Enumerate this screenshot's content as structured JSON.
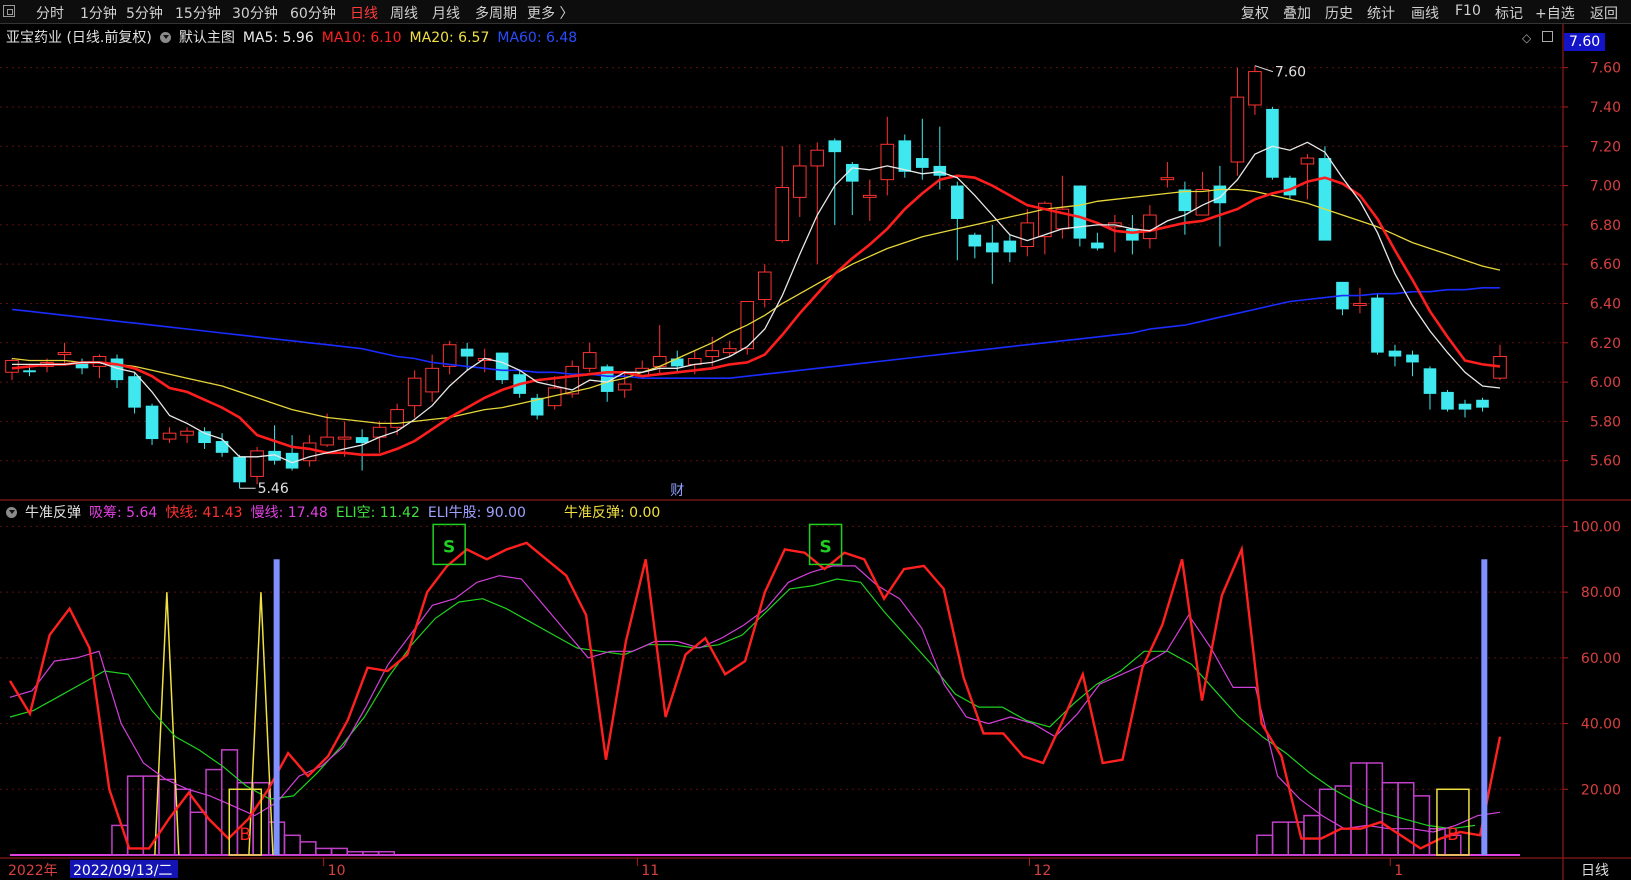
{
  "toolbar": {
    "left_items": [
      "分时",
      "1分钟",
      "5分钟",
      "15分钟",
      "30分钟",
      "60分钟",
      "日线",
      "周线",
      "月线",
      "多周期",
      "更多 〉"
    ],
    "active": "日线",
    "right_items": [
      "复权",
      "叠加",
      "历史",
      "统计",
      "画线",
      "F10",
      "标记",
      "+自选",
      "返回"
    ]
  },
  "main_legend": {
    "stock": "亚宝药业 (日线.前复权)",
    "template": "默认主图",
    "ma5": "MA5: 5.96",
    "ma10": "MA10: 6.10",
    "ma20": "MA20: 6.57",
    "ma60": "MA60: 6.48",
    "ma5_color": "#e8e8e8",
    "ma10_color": "#ff2020",
    "ma20_color": "#f0e040",
    "ma60_color": "#2038ff"
  },
  "sub_legend": {
    "name": "牛准反弹",
    "xichou": "吸筹: 5.64",
    "kuaixian": "快线: 41.43",
    "manxian": "慢线: 17.48",
    "elikong": "ELI空: 11.42",
    "eliniugu": "ELI牛股: 90.00",
    "niuzhun": "牛准反弹: 0.00",
    "xichou_color": "#e040e0",
    "kuaixian_color": "#ff3030",
    "manxian_color": "#e040e0",
    "elikong_color": "#40e040",
    "eliniugu_color": "#a0a0ff",
    "niuzhun_color": "#f0e040"
  },
  "price_tag": "7.60",
  "bottom_right_tab": "日线",
  "chart_data": [
    {
      "type": "candlestick",
      "ylim": [
        5.4,
        7.7
      ],
      "yticks": [
        "7.60",
        "7.40",
        "7.20",
        "7.00",
        "6.80",
        "6.60",
        "6.40",
        "6.20",
        "6.00",
        "5.80",
        "5.60"
      ],
      "annotations": {
        "high_label": "7.60",
        "low_label": "5.46",
        "event_mark": "财"
      },
      "candles": [
        [
          6.05,
          6.11,
          6.12,
          6.01
        ],
        [
          6.06,
          6.05,
          6.09,
          6.03
        ],
        [
          6.08,
          6.1,
          6.12,
          6.05
        ],
        [
          6.14,
          6.15,
          6.2,
          6.09
        ],
        [
          6.1,
          6.07,
          6.12,
          6.04
        ],
        [
          6.08,
          6.13,
          6.14,
          6.02
        ],
        [
          6.12,
          6.01,
          6.14,
          5.97
        ],
        [
          6.03,
          5.87,
          6.05,
          5.84
        ],
        [
          5.88,
          5.71,
          5.89,
          5.68
        ],
        [
          5.71,
          5.74,
          5.77,
          5.69
        ],
        [
          5.73,
          5.75,
          5.77,
          5.69
        ],
        [
          5.75,
          5.69,
          5.77,
          5.66
        ],
        [
          5.7,
          5.64,
          5.74,
          5.62
        ],
        [
          5.62,
          5.49,
          5.63,
          5.46
        ],
        [
          5.52,
          5.65,
          5.67,
          5.48
        ],
        [
          5.65,
          5.6,
          5.78,
          5.58
        ],
        [
          5.64,
          5.56,
          5.73,
          5.55
        ],
        [
          5.6,
          5.69,
          5.73,
          5.57
        ],
        [
          5.68,
          5.72,
          5.84,
          5.67
        ],
        [
          5.71,
          5.72,
          5.8,
          5.62
        ],
        [
          5.72,
          5.69,
          5.76,
          5.55
        ],
        [
          5.72,
          5.77,
          5.8,
          5.64
        ],
        [
          5.77,
          5.86,
          5.89,
          5.73
        ],
        [
          5.88,
          6.02,
          6.06,
          5.82
        ],
        [
          5.95,
          6.07,
          6.14,
          5.9
        ],
        [
          6.08,
          6.19,
          6.21,
          6.04
        ],
        [
          6.17,
          6.13,
          6.2,
          6.06
        ],
        [
          6.11,
          6.12,
          6.17,
          6.05
        ],
        [
          6.15,
          6.01,
          6.15,
          5.99
        ],
        [
          6.04,
          5.94,
          6.06,
          5.92
        ],
        [
          5.92,
          5.83,
          5.94,
          5.81
        ],
        [
          5.88,
          5.97,
          6.03,
          5.86
        ],
        [
          5.94,
          6.08,
          6.11,
          5.92
        ],
        [
          6.07,
          6.15,
          6.2,
          6.05
        ],
        [
          6.08,
          5.95,
          6.09,
          5.9
        ],
        [
          5.96,
          5.99,
          6.05,
          5.92
        ],
        [
          6.03,
          6.07,
          6.11,
          6.02
        ],
        [
          6.08,
          6.13,
          6.29,
          6.04
        ],
        [
          6.12,
          6.08,
          6.16,
          6.05
        ],
        [
          6.09,
          6.12,
          6.16,
          6.04
        ],
        [
          6.13,
          6.16,
          6.23,
          6.08
        ],
        [
          6.15,
          6.17,
          6.21,
          6.13
        ],
        [
          6.17,
          6.41,
          6.41,
          6.14
        ],
        [
          6.42,
          6.56,
          6.6,
          6.38
        ],
        [
          6.72,
          6.99,
          7.2,
          6.71
        ],
        [
          6.94,
          7.1,
          7.21,
          6.84
        ],
        [
          7.1,
          7.18,
          7.22,
          6.6
        ],
        [
          7.23,
          7.17,
          7.24,
          6.8
        ],
        [
          7.11,
          7.02,
          7.12,
          6.85
        ],
        [
          6.94,
          6.95,
          7.03,
          6.82
        ],
        [
          7.03,
          7.21,
          7.35,
          6.95
        ],
        [
          7.23,
          7.07,
          7.26,
          7.04
        ],
        [
          7.14,
          7.09,
          7.34,
          7.03
        ],
        [
          7.1,
          7.05,
          7.3,
          6.98
        ],
        [
          7.0,
          6.83,
          7.02,
          6.62
        ],
        [
          6.75,
          6.69,
          6.76,
          6.63
        ],
        [
          6.71,
          6.66,
          6.8,
          6.5
        ],
        [
          6.72,
          6.66,
          6.75,
          6.61
        ],
        [
          6.69,
          6.81,
          6.88,
          6.64
        ],
        [
          6.74,
          6.91,
          6.92,
          6.65
        ],
        [
          6.78,
          6.88,
          7.05,
          6.73
        ],
        [
          7.0,
          6.73,
          7.0,
          6.69
        ],
        [
          6.71,
          6.68,
          6.76,
          6.67
        ],
        [
          6.79,
          6.81,
          6.85,
          6.66
        ],
        [
          6.78,
          6.72,
          6.85,
          6.65
        ],
        [
          6.73,
          6.85,
          6.9,
          6.68
        ],
        [
          7.03,
          7.04,
          7.12,
          6.99
        ],
        [
          6.98,
          6.87,
          7.02,
          6.75
        ],
        [
          6.85,
          6.98,
          7.07,
          6.87
        ],
        [
          7.0,
          6.91,
          7.1,
          6.69
        ],
        [
          7.12,
          7.45,
          7.6,
          7.05
        ],
        [
          7.41,
          7.58,
          7.61,
          7.36
        ],
        [
          7.39,
          7.04,
          7.4,
          7.03
        ],
        [
          7.04,
          6.95,
          7.05,
          6.93
        ],
        [
          7.11,
          7.14,
          7.16,
          6.93
        ],
        [
          7.14,
          6.72,
          7.2,
          6.72
        ],
        [
          6.51,
          6.37,
          6.51,
          6.34
        ],
        [
          6.39,
          6.4,
          6.48,
          6.35
        ],
        [
          6.43,
          6.15,
          6.45,
          6.14
        ],
        [
          6.16,
          6.13,
          6.19,
          6.08
        ],
        [
          6.14,
          6.1,
          6.16,
          6.03
        ],
        [
          6.07,
          5.94,
          6.08,
          5.86
        ],
        [
          5.95,
          5.86,
          5.96,
          5.85
        ],
        [
          5.89,
          5.86,
          5.91,
          5.82
        ],
        [
          5.91,
          5.87,
          5.92,
          5.85
        ],
        [
          6.02,
          6.13,
          6.19,
          6.01
        ]
      ],
      "ma5": [
        6.09,
        6.09,
        6.09,
        6.09,
        6.1,
        6.1,
        6.07,
        6.05,
        5.95,
        5.83,
        5.79,
        5.74,
        5.71,
        5.62,
        5.62,
        5.63,
        5.59,
        5.62,
        5.64,
        5.66,
        5.68,
        5.72,
        5.75,
        5.81,
        5.88,
        5.98,
        6.06,
        6.12,
        6.1,
        6.06,
        6.0,
        5.98,
        5.96,
        6.01,
        6.0,
        6.05,
        6.05,
        6.07,
        6.07,
        6.09,
        6.1,
        6.13,
        6.18,
        6.27,
        6.44,
        6.65,
        6.85,
        7.0,
        7.09,
        7.08,
        7.1,
        7.08,
        7.06,
        7.07,
        7.04,
        6.95,
        6.85,
        6.75,
        6.72,
        6.75,
        6.78,
        6.79,
        6.8,
        6.8,
        6.78,
        6.77,
        6.82,
        6.85,
        6.9,
        6.94,
        7.03,
        7.16,
        7.2,
        7.18,
        7.22,
        7.17,
        7.04,
        6.92,
        6.76,
        6.55,
        6.39,
        6.26,
        6.15,
        6.05,
        5.98,
        5.97
      ],
      "ma10": [
        6.07,
        6.08,
        6.09,
        6.09,
        6.1,
        6.1,
        6.09,
        6.07,
        6.03,
        5.97,
        5.95,
        5.91,
        5.87,
        5.82,
        5.73,
        5.7,
        5.67,
        5.66,
        5.64,
        5.64,
        5.63,
        5.63,
        5.66,
        5.7,
        5.76,
        5.82,
        5.87,
        5.92,
        5.96,
        5.99,
        6.01,
        6.02,
        6.03,
        6.04,
        6.05,
        6.05,
        6.03,
        6.04,
        6.05,
        6.06,
        6.07,
        6.09,
        6.1,
        6.14,
        6.24,
        6.35,
        6.45,
        6.55,
        6.63,
        6.7,
        6.78,
        6.88,
        6.96,
        7.03,
        7.05,
        7.04,
        7.0,
        6.95,
        6.9,
        6.88,
        6.86,
        6.84,
        6.81,
        6.77,
        6.76,
        6.77,
        6.79,
        6.81,
        6.82,
        6.85,
        6.88,
        6.93,
        6.96,
        6.98,
        7.02,
        7.04,
        7.01,
        6.95,
        6.83,
        6.67,
        6.52,
        6.36,
        6.23,
        6.11,
        6.09,
        6.08
      ],
      "ma20": [
        6.12,
        6.11,
        6.11,
        6.11,
        6.1,
        6.1,
        6.09,
        6.08,
        6.06,
        6.04,
        6.02,
        6.0,
        5.98,
        5.95,
        5.92,
        5.89,
        5.86,
        5.84,
        5.82,
        5.81,
        5.8,
        5.79,
        5.79,
        5.8,
        5.81,
        5.82,
        5.84,
        5.86,
        5.87,
        5.89,
        5.91,
        5.93,
        5.95,
        5.97,
        6.0,
        6.02,
        6.05,
        6.08,
        6.12,
        6.16,
        6.2,
        6.25,
        6.29,
        6.34,
        6.4,
        6.45,
        6.5,
        6.55,
        6.6,
        6.64,
        6.68,
        6.71,
        6.74,
        6.76,
        6.78,
        6.8,
        6.82,
        6.84,
        6.86,
        6.88,
        6.89,
        6.9,
        6.92,
        6.93,
        6.94,
        6.95,
        6.96,
        6.97,
        6.97,
        6.98,
        6.98,
        6.97,
        6.95,
        6.93,
        6.91,
        6.88,
        6.85,
        6.82,
        6.79,
        6.75,
        6.71,
        6.68,
        6.65,
        6.62,
        6.59,
        6.57
      ],
      "ma60": [
        6.37,
        6.36,
        6.35,
        6.34,
        6.33,
        6.32,
        6.31,
        6.3,
        6.29,
        6.28,
        6.27,
        6.26,
        6.25,
        6.24,
        6.23,
        6.22,
        6.21,
        6.2,
        6.19,
        6.18,
        6.17,
        6.15,
        6.13,
        6.12,
        6.1,
        6.09,
        6.08,
        6.07,
        6.06,
        6.06,
        6.05,
        6.05,
        6.04,
        6.04,
        6.03,
        6.03,
        6.02,
        6.02,
        6.02,
        6.02,
        6.02,
        6.02,
        6.03,
        6.04,
        6.05,
        6.06,
        6.07,
        6.08,
        6.09,
        6.1,
        6.11,
        6.12,
        6.13,
        6.14,
        6.15,
        6.16,
        6.17,
        6.18,
        6.19,
        6.2,
        6.21,
        6.22,
        6.23,
        6.24,
        6.25,
        6.27,
        6.28,
        6.29,
        6.31,
        6.33,
        6.35,
        6.37,
        6.39,
        6.41,
        6.42,
        6.43,
        6.44,
        6.44,
        6.45,
        6.45,
        6.46,
        6.46,
        6.47,
        6.47,
        6.48,
        6.48
      ]
    },
    {
      "type": "line",
      "ylim": [
        0,
        105
      ],
      "yticks": [
        "100.00",
        "80.00",
        "60.00",
        "40.00",
        "20.00"
      ],
      "x_labels": {
        "year": "2022年",
        "cursor_date": "2022/09/13/二",
        "months": [
          "10",
          "11",
          "12",
          "1"
        ],
        "month_at": [
          20,
          40,
          65,
          88
        ]
      },
      "kuaixian": [
        53,
        43,
        67,
        75,
        63,
        20,
        2,
        2,
        11,
        19,
        11,
        5,
        11,
        20,
        31,
        24,
        30,
        41,
        57,
        56,
        61,
        80,
        88,
        93,
        90,
        93,
        95,
        90,
        85,
        73,
        29,
        65,
        90,
        42,
        61,
        66,
        55,
        59,
        80,
        93,
        92,
        87,
        92,
        90,
        78,
        87,
        88,
        81,
        54,
        37,
        37,
        30,
        28,
        41,
        55,
        28,
        29,
        57,
        70,
        90,
        47,
        79,
        93,
        40,
        30,
        5,
        5,
        8,
        8,
        10,
        6,
        2,
        5,
        7,
        6,
        36
      ],
      "manxian": [
        48,
        50,
        59,
        60,
        62,
        40,
        28,
        23,
        20,
        18,
        15,
        12,
        16,
        24,
        27,
        33,
        45,
        58,
        67,
        76,
        78,
        83,
        85,
        84,
        76,
        68,
        60,
        62,
        62,
        65,
        65,
        63,
        66,
        70,
        75,
        83,
        86,
        88,
        88,
        82,
        78,
        69,
        52,
        42,
        40,
        42,
        40,
        36,
        43,
        52,
        55,
        58,
        62,
        73,
        63,
        51,
        51,
        24,
        17,
        12,
        8,
        9,
        8,
        8,
        7,
        9,
        12,
        13
      ],
      "elikong": [
        42,
        44,
        48,
        52,
        56,
        55,
        44,
        36,
        32,
        27,
        21,
        17,
        18,
        25,
        33,
        42,
        54,
        64,
        72,
        77,
        78,
        75,
        71,
        67,
        63,
        62,
        61,
        64,
        64,
        63,
        64,
        67,
        74,
        81,
        82,
        84,
        83,
        74,
        66,
        58,
        49,
        45,
        45,
        41,
        39,
        46,
        52,
        56,
        62,
        62,
        58,
        50,
        42,
        36,
        31,
        25,
        20,
        16,
        13,
        11,
        9,
        8,
        9
      ],
      "eliniugu_bars": [
        {
          "i": 17,
          "v": 90
        },
        {
          "i": 94,
          "v": 90
        }
      ],
      "niuzhun_spikes": [
        {
          "i": 10,
          "v": 80
        },
        {
          "i": 16,
          "v": 80
        }
      ],
      "signals": [
        {
          "type": "S",
          "i": 28,
          "level": 80
        },
        {
          "type": "S",
          "i": 52,
          "level": 80
        },
        {
          "type": "B",
          "i": 15,
          "level": 0
        },
        {
          "type": "B",
          "i": 92,
          "level": 0
        }
      ],
      "xichou_steps": [
        [
          7,
          9
        ],
        [
          8,
          24
        ],
        [
          9,
          24
        ],
        [
          10,
          23
        ],
        [
          11,
          20
        ],
        [
          12,
          13
        ],
        [
          13,
          26
        ],
        [
          14,
          32
        ],
        [
          15,
          22
        ],
        [
          16,
          22
        ],
        [
          17,
          10
        ],
        [
          18,
          6
        ],
        [
          19,
          4
        ],
        [
          20,
          2
        ],
        [
          21,
          2
        ],
        [
          22,
          1
        ],
        [
          23,
          1
        ],
        [
          24,
          1
        ],
        [
          25,
          0
        ],
        [
          80,
          6
        ],
        [
          81,
          10
        ],
        [
          82,
          10
        ],
        [
          83,
          12
        ],
        [
          84,
          20
        ],
        [
          85,
          21
        ],
        [
          86,
          28
        ],
        [
          87,
          28
        ],
        [
          88,
          22
        ],
        [
          89,
          22
        ],
        [
          90,
          18
        ],
        [
          91,
          8
        ],
        [
          92,
          6
        ]
      ]
    }
  ]
}
